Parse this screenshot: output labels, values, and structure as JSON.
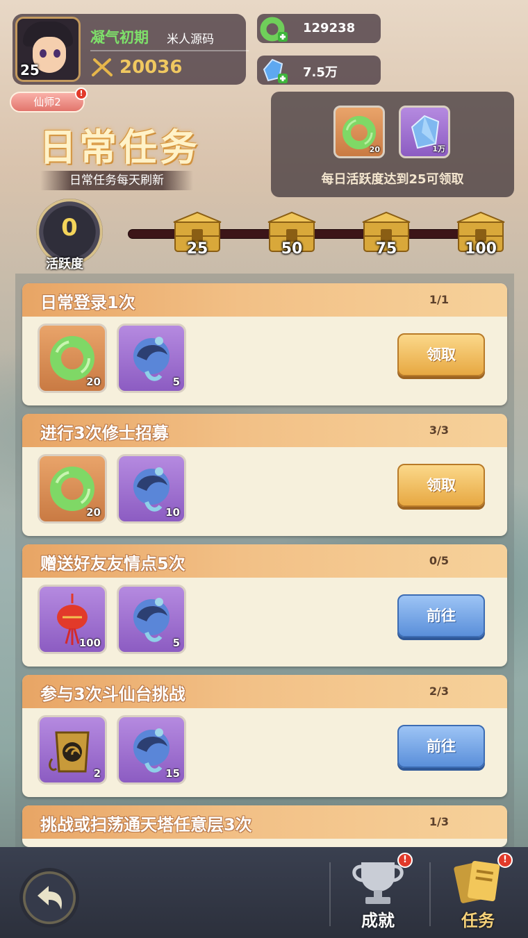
{
  "player": {
    "level": "25",
    "realm": "凝气初期",
    "name": "米人源码",
    "power": "20036"
  },
  "resources": {
    "jade": "129238",
    "crystal": "7.5万"
  },
  "title_badge": "仙师2",
  "page": {
    "title": "日常任务",
    "subtitle": "日常任务每天刷新"
  },
  "daily_reward": {
    "items": [
      {
        "icon": "jade-ring-icon",
        "qty": "20"
      },
      {
        "icon": "blue-crystal-icon",
        "qty": "1万"
      }
    ],
    "text": "每日活跃度达到25可领取"
  },
  "activity": {
    "value": "0",
    "label": "活跃度",
    "milestones": [
      "25",
      "50",
      "75",
      "100"
    ]
  },
  "tasks": [
    {
      "name": "日常登录1次",
      "progress": "1/1",
      "button": "领取",
      "items": [
        {
          "icon": "jade-ring-icon",
          "qty": "20"
        },
        {
          "icon": "spirit-fish-icon",
          "qty": "5"
        }
      ]
    },
    {
      "name": "进行3次修士招募",
      "progress": "3/3",
      "button": "领取",
      "items": [
        {
          "icon": "jade-ring-icon",
          "qty": "20"
        },
        {
          "icon": "spirit-fish-icon",
          "qty": "10"
        }
      ]
    },
    {
      "name": "赠送好友友情点5次",
      "progress": "0/5",
      "button": "前往",
      "items": [
        {
          "icon": "red-lantern-charm-icon",
          "qty": "100"
        },
        {
          "icon": "spirit-fish-icon",
          "qty": "5"
        }
      ]
    },
    {
      "name": "参与3次斗仙台挑战",
      "progress": "2/3",
      "button": "前往",
      "items": [
        {
          "icon": "gold-token-icon",
          "qty": "2"
        },
        {
          "icon": "spirit-fish-icon",
          "qty": "15"
        }
      ]
    },
    {
      "name": "挑战或扫荡通天塔任意层3次",
      "progress": "1/3"
    }
  ],
  "nav": {
    "achievement": "成就",
    "task": "任务"
  },
  "badge": "!"
}
